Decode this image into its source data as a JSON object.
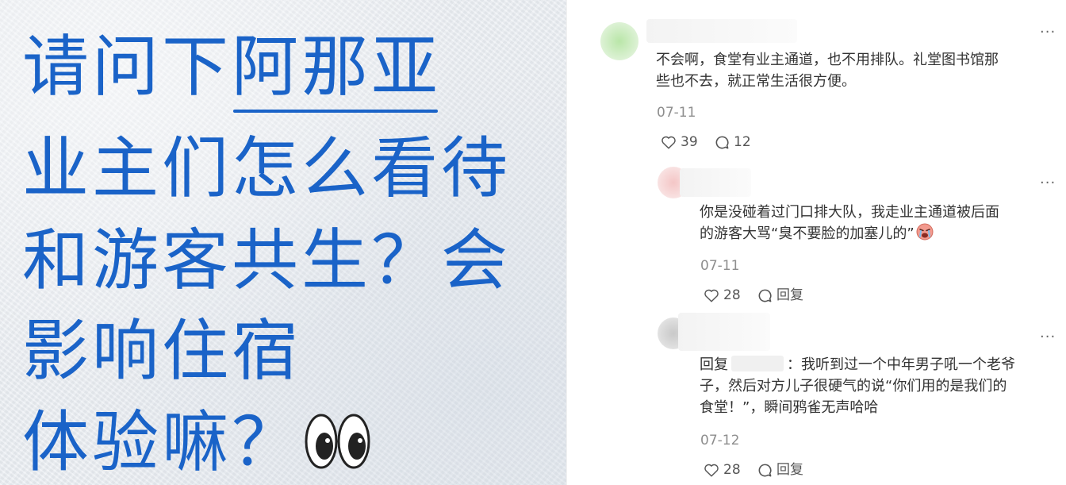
{
  "question_card": {
    "line1_prefix": "请问下",
    "line1_highlight": "阿那亚",
    "line2": "业主们怎么看待",
    "line3": "和游客共生？会",
    "line4": "影响住宿",
    "line5": "体验嘛？",
    "text_color": "#1a63c8",
    "eyes_emoji_icon": "eyes-icon"
  },
  "comments": [
    {
      "text": "不会啊，食堂有业主通道，也不用排队。礼堂图书馆那些也不去，就正常生活很方便。",
      "line1": "不会啊，食堂有业主通道，也不用排队。礼堂图书馆那",
      "line2": "些也不去，就正常生活很方便。",
      "date": "07-11",
      "likes": "39",
      "replies": "12",
      "more": "···"
    },
    {
      "line1": "你是没碰着过门口排大队，我走业主通道被后面",
      "line2": "的游客大骂“臭不要脸的加塞儿的”",
      "date": "07-11",
      "likes": "28",
      "reply_label": "回复",
      "more": "···"
    },
    {
      "reply_prefix": "回复",
      "line1_rest": "：我听到过一个中年男子吼一个老爷",
      "line2": "子，然后对方儿子很硬气的说“你们用的是我们的",
      "line3": "食堂！”，瞬间鸦雀无声哈哈",
      "date": "07-12",
      "likes": "28",
      "reply_label": "回复",
      "more": "···"
    }
  ]
}
